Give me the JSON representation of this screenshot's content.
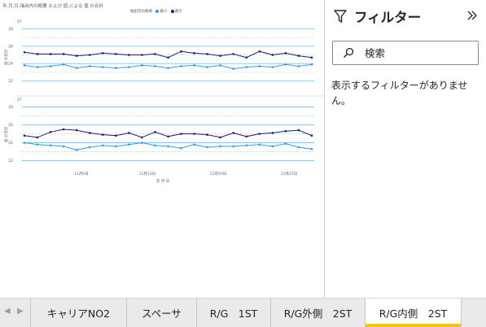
{
  "report": {
    "chart_title": "年,月,日,抽出内の概要 および 値,による 値 の合計",
    "legend_title": "抽出内の概要",
    "legend_items": [
      {
        "label": "最小",
        "color": "#2a9fe8"
      },
      {
        "label": "最大",
        "color": "#1c1b6e"
      }
    ],
    "x_axis_title": "年 月 日",
    "top_panel_label": "ST",
    "bottom_panel_label": "ST",
    "y_axis_title": "値 の合計"
  },
  "chart_data": [
    {
      "type": "line",
      "panel": "ST (上段)",
      "x_ticks": [
        "11月6日",
        "11月13日",
        "11月20日",
        "11月27日"
      ],
      "y_ticks": [
        22,
        24,
        26,
        28
      ],
      "ylim": [
        21.5,
        28.5
      ],
      "reference_lines": [
        28,
        26,
        24,
        22
      ],
      "series": [
        {
          "name": "最大",
          "color": "#1c1b6e",
          "values": [
            25.3,
            25.1,
            25.1,
            25.1,
            24.9,
            25.0,
            25.2,
            25.1,
            25.0,
            25.0,
            25.1,
            24.7,
            25.4,
            25.2,
            25.1,
            24.9,
            25.1,
            24.7,
            25.4,
            25.0,
            25.2,
            24.9,
            24.7
          ]
        },
        {
          "name": "最小",
          "color": "#2a9fe8",
          "values": [
            23.8,
            23.6,
            23.7,
            23.9,
            23.5,
            23.7,
            23.6,
            23.5,
            23.6,
            23.8,
            23.7,
            23.5,
            23.7,
            23.8,
            23.6,
            23.8,
            23.4,
            23.6,
            23.7,
            23.6,
            23.9,
            23.7,
            23.9
          ]
        }
      ]
    },
    {
      "type": "line",
      "panel": "ST (下段)",
      "x_ticks": [
        "11月6日",
        "11月13日",
        "11月20日",
        "11月27日"
      ],
      "y_ticks": [
        22,
        24,
        26,
        28
      ],
      "ylim": [
        21.5,
        28.5
      ],
      "reference_lines": [
        28,
        26,
        24,
        22
      ],
      "series": [
        {
          "name": "最大",
          "color": "#1c1b6e",
          "values": [
            24.8,
            24.6,
            25.2,
            25.5,
            25.4,
            25.1,
            24.9,
            24.8,
            25.1,
            24.6,
            25.2,
            24.7,
            25.0,
            25.0,
            24.9,
            24.6,
            25.1,
            24.7,
            25.0,
            25.1,
            25.3,
            25.4,
            24.8
          ]
        },
        {
          "name": "最小",
          "color": "#2a9fe8",
          "values": [
            24.0,
            23.8,
            23.7,
            23.6,
            23.2,
            23.5,
            23.7,
            23.6,
            23.8,
            24.0,
            23.7,
            23.6,
            23.4,
            23.8,
            23.5,
            23.6,
            23.6,
            23.7,
            23.8,
            23.6,
            23.9,
            23.5,
            23.3
          ]
        }
      ]
    }
  ],
  "filter_pane": {
    "title": "フィルター",
    "search_placeholder": "検索",
    "empty_message": "表示するフィルターがありません。"
  },
  "tabs": [
    {
      "label": "キャリアNO2",
      "active": false
    },
    {
      "label": "スペーサ",
      "active": false
    },
    {
      "label": "R/G　1ST",
      "active": false
    },
    {
      "label": "R/G外側　2ST",
      "active": false
    },
    {
      "label": "R/G内側　2ST",
      "active": true
    }
  ]
}
